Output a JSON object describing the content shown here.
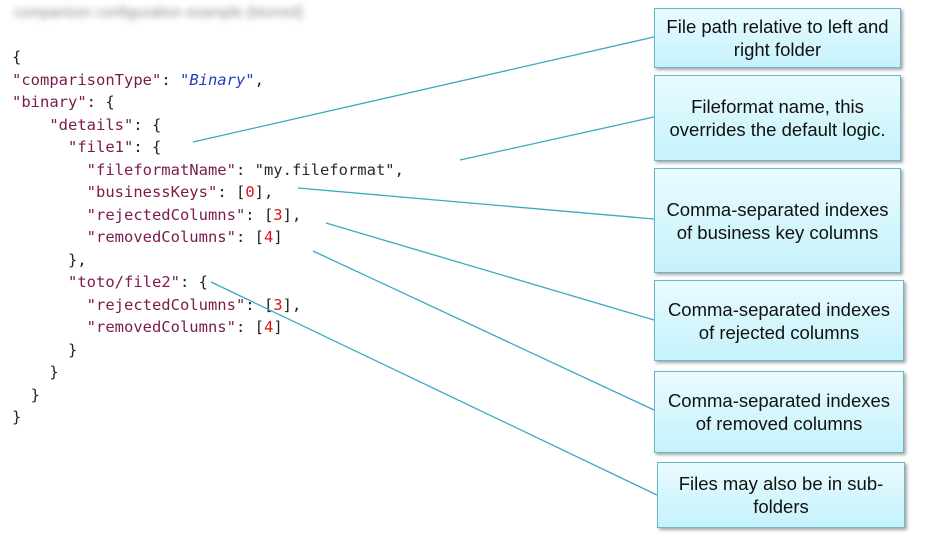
{
  "blurred_header": "comparison configuration example (blurred)",
  "code_lines": [
    [
      {
        "t": "{",
        "c": "p"
      }
    ],
    [
      {
        "t": "\"comparisonType\"",
        "c": "k"
      },
      {
        "t": ": ",
        "c": "p"
      },
      {
        "t": "\"Binary\"",
        "c": "i"
      },
      {
        "t": ",",
        "c": "p"
      }
    ],
    [
      {
        "t": "\"binary\"",
        "c": "k"
      },
      {
        "t": ": {",
        "c": "p"
      }
    ],
    [
      {
        "t": "    ",
        "c": "p"
      },
      {
        "t": "\"details\"",
        "c": "k"
      },
      {
        "t": ": {",
        "c": "p"
      }
    ],
    [
      {
        "t": "      ",
        "c": "p"
      },
      {
        "t": "\"file1\"",
        "c": "k"
      },
      {
        "t": ": {",
        "c": "p"
      }
    ],
    [
      {
        "t": "        ",
        "c": "p"
      },
      {
        "t": "\"fileformatName\"",
        "c": "k"
      },
      {
        "t": ": ",
        "c": "p"
      },
      {
        "t": "\"my.fileformat\"",
        "c": "v"
      },
      {
        "t": ",",
        "c": "p"
      }
    ],
    [
      {
        "t": "        ",
        "c": "p"
      },
      {
        "t": "\"businessKeys\"",
        "c": "k"
      },
      {
        "t": ": [",
        "c": "p"
      },
      {
        "t": "0",
        "c": "n"
      },
      {
        "t": "],",
        "c": "p"
      }
    ],
    [
      {
        "t": "        ",
        "c": "p"
      },
      {
        "t": "\"rejectedColumns\"",
        "c": "k"
      },
      {
        "t": ": [",
        "c": "p"
      },
      {
        "t": "3",
        "c": "n"
      },
      {
        "t": "],",
        "c": "p"
      }
    ],
    [
      {
        "t": "        ",
        "c": "p"
      },
      {
        "t": "\"removedColumns\"",
        "c": "k"
      },
      {
        "t": ": [",
        "c": "p"
      },
      {
        "t": "4",
        "c": "n"
      },
      {
        "t": "]",
        "c": "p"
      }
    ],
    [
      {
        "t": "      },",
        "c": "p"
      }
    ],
    [
      {
        "t": "      ",
        "c": "p"
      },
      {
        "t": "\"toto/file2\"",
        "c": "k"
      },
      {
        "t": ": {",
        "c": "p"
      }
    ],
    [
      {
        "t": "        ",
        "c": "p"
      },
      {
        "t": "\"rejectedColumns\"",
        "c": "k"
      },
      {
        "t": ": [",
        "c": "p"
      },
      {
        "t": "3",
        "c": "n"
      },
      {
        "t": "],",
        "c": "p"
      }
    ],
    [
      {
        "t": "        ",
        "c": "p"
      },
      {
        "t": "\"removedColumns\"",
        "c": "k"
      },
      {
        "t": ": [",
        "c": "p"
      },
      {
        "t": "4",
        "c": "n"
      },
      {
        "t": "]",
        "c": "p"
      }
    ],
    [
      {
        "t": "      }",
        "c": "p"
      }
    ],
    [
      {
        "t": "    }",
        "c": "p"
      }
    ],
    [
      {
        "t": "  }",
        "c": "p"
      }
    ],
    [
      {
        "t": "}",
        "c": "p"
      }
    ]
  ],
  "callouts": {
    "file_path": "File path relative to left and right folder",
    "fileformat": "Fileformat name, this overrides the default logic.",
    "business_keys": "Comma-separated indexes of business key columns",
    "rejected": "Comma-separated indexes of rejected columns",
    "removed": "Comma-separated indexes of removed columns",
    "subfolders": "Files may also be in sub-folders"
  },
  "colors": {
    "key": "#7b1a4c",
    "number": "#d4161a",
    "italic_value": "#1f3fbf",
    "callout_line": "#3aa9c2",
    "callout_fill": "#c5f2fb"
  }
}
